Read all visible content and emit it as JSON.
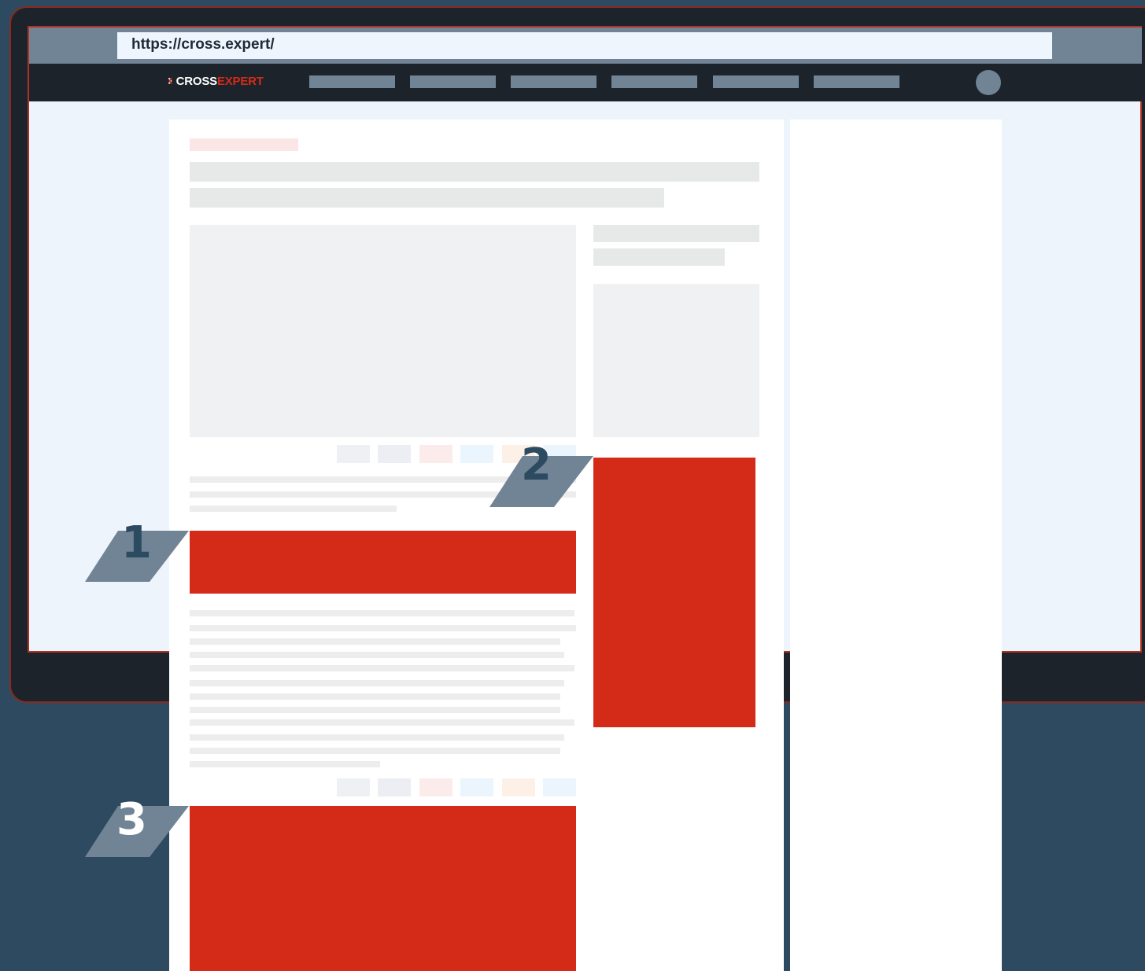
{
  "browser": {
    "url": "https://cross.expert/"
  },
  "brand": {
    "logo_part1": "CROSS",
    "logo_part2": "EXPERT"
  },
  "ad_slots": [
    {
      "number": "1"
    },
    {
      "number": "2"
    },
    {
      "number": "3"
    }
  ],
  "colors": {
    "background": "#2e4a60",
    "monitor_frame": "#1d232b",
    "accent_red": "#d42b18",
    "placeholder_gray": "#708496",
    "screen_bg": "#edf4fb"
  }
}
